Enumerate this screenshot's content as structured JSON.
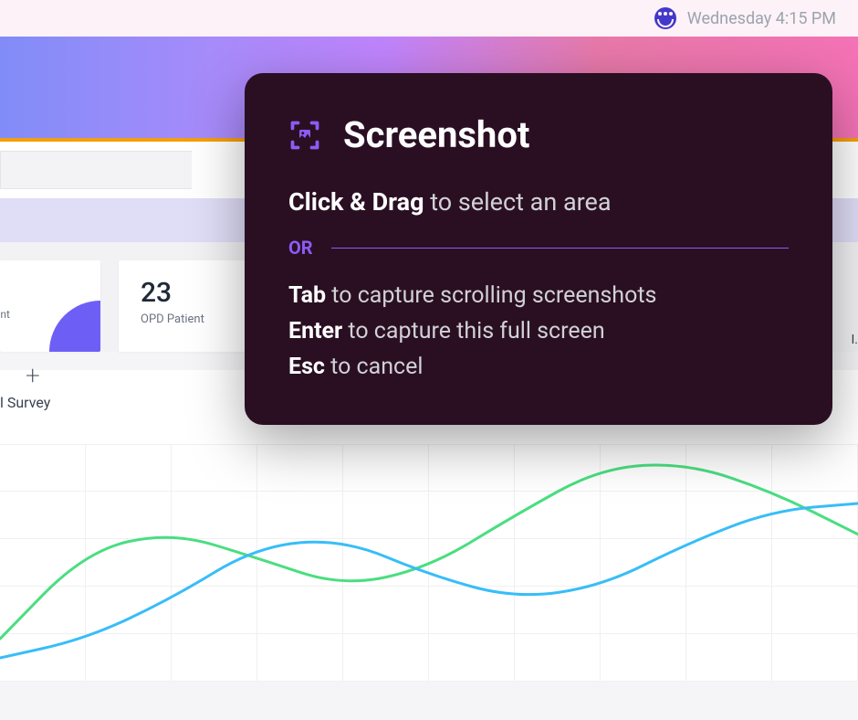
{
  "status": {
    "datetime": "Wednesday 4:15 PM"
  },
  "cards": {
    "card1_label": "ent",
    "card2_value": "23",
    "card2_label": "OPD Patient",
    "right_stub": "I."
  },
  "survey": {
    "title_fragment": "l Survey"
  },
  "overlay": {
    "title": "Screenshot",
    "line1_bold": "Click & Drag",
    "line1_rest": " to select an area",
    "or": "OR",
    "tab_bold": "Tab",
    "tab_rest": " to capture scrolling screenshots",
    "enter_bold": "Enter",
    "enter_rest": " to capture this full screen",
    "esc_bold": "Esc",
    "esc_rest": " to cancel"
  },
  "chart_data": {
    "type": "line",
    "title": "",
    "xlabel": "",
    "ylabel": "",
    "x": [
      0,
      0.1,
      0.2,
      0.3,
      0.4,
      0.5,
      0.6,
      0.7,
      0.8,
      0.9,
      1.0
    ],
    "series": [
      {
        "name": "green",
        "color": "#4ade80",
        "values": [
          18,
          55,
          63,
          52,
          40,
          48,
          70,
          90,
          92,
          80,
          62
        ]
      },
      {
        "name": "blue",
        "color": "#38bdf8",
        "values": [
          10,
          18,
          35,
          57,
          60,
          45,
          35,
          40,
          58,
          72,
          75
        ]
      }
    ],
    "ylim": [
      0,
      100
    ]
  }
}
